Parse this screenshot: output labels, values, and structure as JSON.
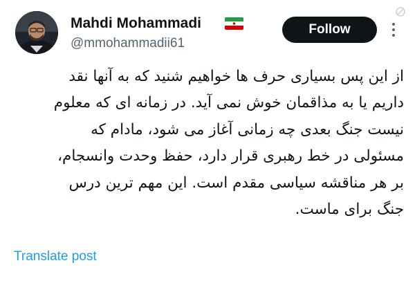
{
  "author": {
    "display_name": "Mahdi Mohammadi",
    "handle": "@mmohammadii61",
    "flag_icon": "iran-flag-icon"
  },
  "actions": {
    "follow_label": "Follow",
    "more_icon": "more-vertical-icon"
  },
  "tweet": {
    "lines": [
      "از این پس بسیاری حرف ها خواهیم شنید که به آنها نقد",
      "داریم یا به مذاقمان خوش نمی آید. در زمانه ای که معلوم",
      "نیست جنگ بعدی چه زمانی آغاز می شود، مادام که",
      "مسئولی در خط رهبری قرار دارد، حفظ وحدت وانسجام،",
      "بر هر مناقشه سیاسی مقدم است. این مهم ترین درس",
      "جنگ برای ماست."
    ]
  },
  "translate": {
    "label": "Translate post"
  },
  "colors": {
    "text": "#0f1419",
    "secondary": "#536471",
    "link": "#1d9bf0",
    "button_bg": "#0f1419",
    "button_text": "#ffffff"
  }
}
